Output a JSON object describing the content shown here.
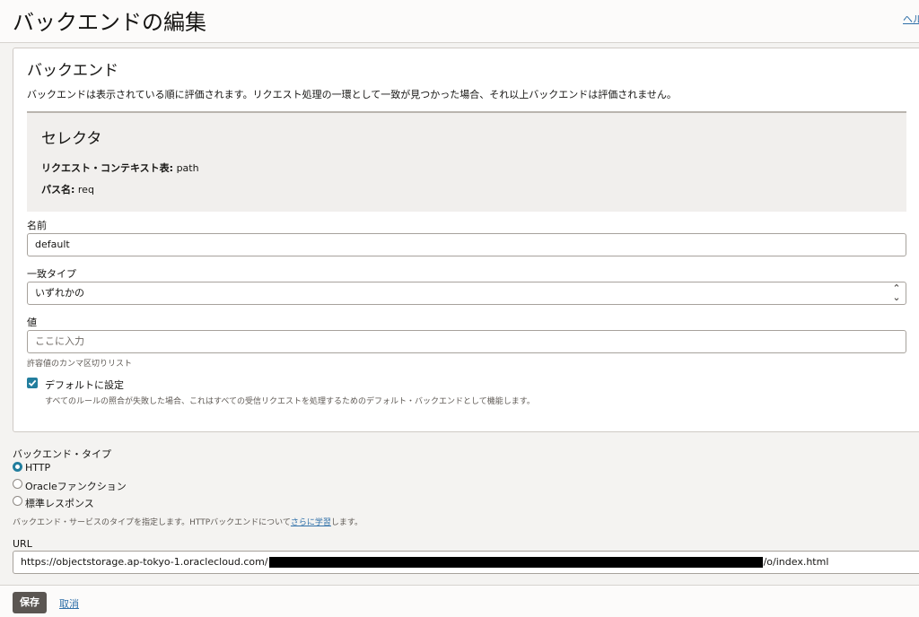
{
  "header": {
    "title": "バックエンドの編集",
    "help_link": "ヘル"
  },
  "backends": {
    "title": "バックエンド",
    "description": "バックエンドは表示されている順に評価されます。リクエスト処理の一環として一致が見つかった場合、それ以上バックエンドは評価されません。",
    "selector": {
      "title": "セレクタ",
      "context_label": "リクエスト・コンテキスト表:",
      "context_value": "path",
      "path_label": "パス名:",
      "path_value": "req"
    },
    "name": {
      "label": "名前",
      "value": "default"
    },
    "match_type": {
      "label": "一致タイプ",
      "value": "いずれかの"
    },
    "values": {
      "label": "値",
      "placeholder": "ここに入力",
      "hint": "許容値のカンマ区切りリスト"
    },
    "default_checkbox": {
      "label": "デフォルトに設定",
      "checked": true,
      "hint": "すべてのルールの照合が失敗した場合、これはすべての受信リクエストを処理するためのデフォルト・バックエンドとして機能します。"
    }
  },
  "backend_type": {
    "label": "バックエンド・タイプ",
    "options": [
      {
        "label": "HTTP",
        "selected": true
      },
      {
        "label": "Oracleファンクション",
        "selected": false
      },
      {
        "label": "標準レスポンス",
        "selected": false
      }
    ],
    "hint_prefix": "バックエンド・サービスのタイプを指定します。HTTPバックエンドについて",
    "hint_link": "さらに学習",
    "hint_suffix": "します。"
  },
  "url": {
    "label": "URL",
    "value_prefix": "https://objectstorage.ap-tokyo-1.oraclecloud.com/",
    "value_suffix": "/o/index.html"
  },
  "footer": {
    "save_label": "保存",
    "cancel_label": "取消"
  },
  "colors": {
    "accent": "#227e9e",
    "link": "#2e6fa8",
    "primary_button": "#5b5652"
  }
}
